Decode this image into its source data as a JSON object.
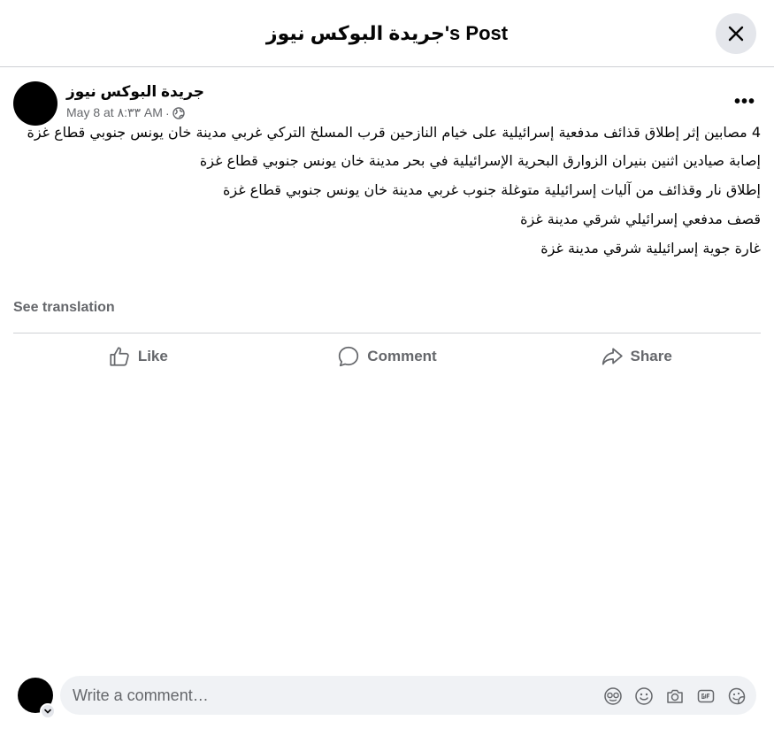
{
  "dialog": {
    "title": "جريدة البوكس نيوز's Post"
  },
  "post": {
    "author": "جريدة البوكس نيوز",
    "date": "May 8 at ٨:٣٣ AM",
    "separator": "·",
    "paragraphs": [
      "4 مصابين إثر إطلاق قذائف مدفعية إسرائيلية على خيام النازحين قرب المسلخ التركي غربي مدينة خان يونس جنوبي قطاع غزة",
      "إصابة صيادين اثنين بنيران الزوارق البحرية الإسرائيلية في بحر مدينة خان يونس جنوبي قطاع غزة",
      "إطلاق نار وقذائف من آليات إسرائيلية متوغلة جنوب غربي مدينة خان يونس جنوبي قطاع غزة",
      "قصف مدفعي إسرائيلي شرقي مدينة غزة",
      "غارة جوية إسرائيلية شرقي مدينة غزة"
    ],
    "see_translation": "See translation",
    "more": "•••"
  },
  "actions": {
    "like": "Like",
    "comment": "Comment",
    "share": "Share"
  },
  "comment_box": {
    "placeholder": "Write a comment…"
  },
  "icons": {
    "close": "close-icon",
    "globe": "globe-icon",
    "like": "thumbs-up-icon",
    "comment": "speech-bubble-icon",
    "share": "share-arrow-icon",
    "avatar_sticker": "avatar-sticker-icon",
    "emoji": "emoji-icon",
    "camera": "camera-icon",
    "gif": "gif-icon",
    "sticker": "sticker-icon"
  },
  "colors": {
    "secondary_text": "#65676b",
    "divider": "#ced0d4",
    "button_bg": "#e4e6eb",
    "input_bg": "#f0f2f5"
  }
}
